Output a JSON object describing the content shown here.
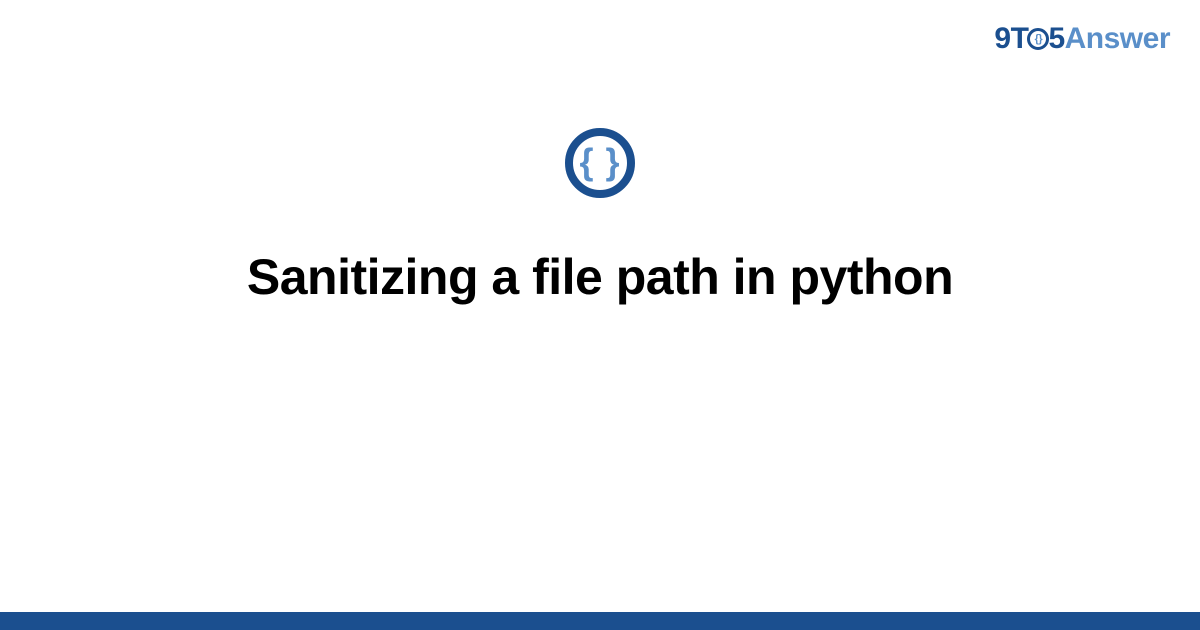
{
  "brand": {
    "part1": "9T",
    "part2": "5",
    "part3": "Answer",
    "o_glyph": "{}"
  },
  "icon": {
    "glyph": "{ }"
  },
  "title": "Sanitizing a file path in python"
}
